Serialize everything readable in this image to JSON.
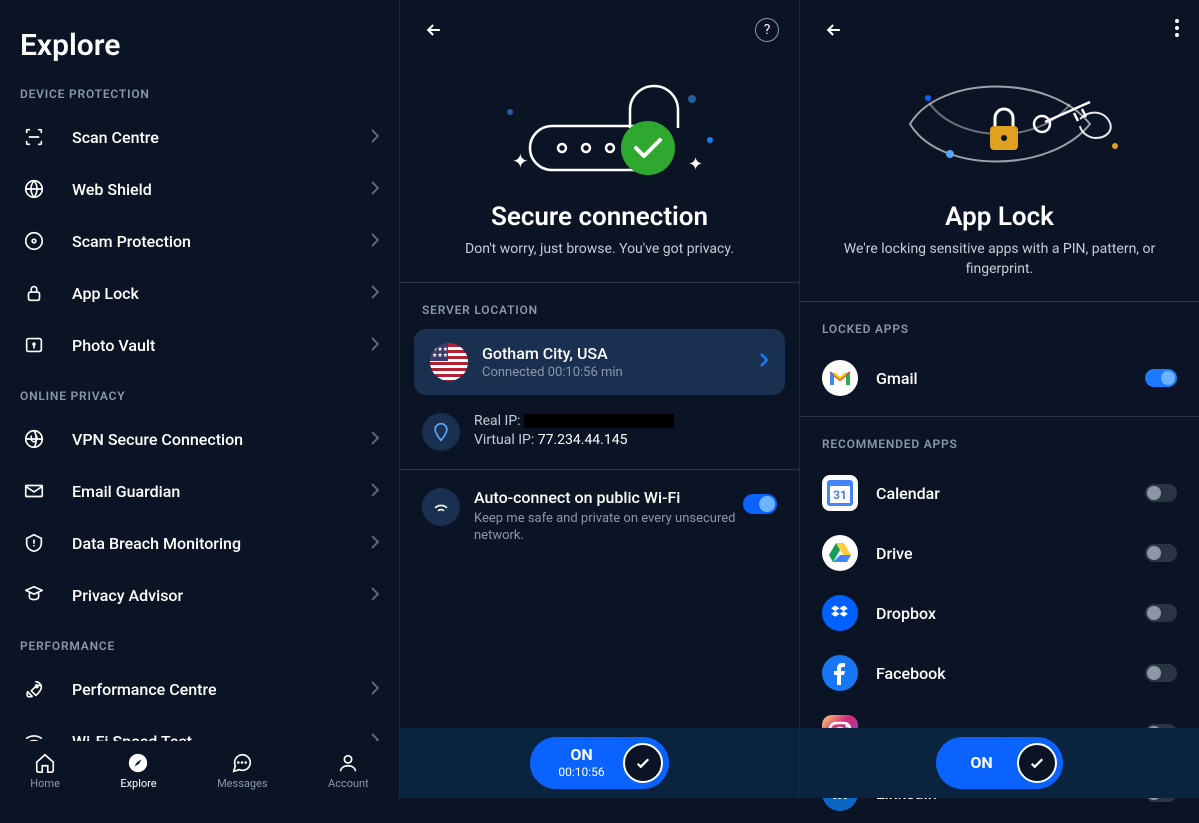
{
  "panel1": {
    "title": "Explore",
    "sections": [
      {
        "header": "DEVICE PROTECTION",
        "items": [
          {
            "label": "Scan Centre",
            "icon": "scan-icon"
          },
          {
            "label": "Web Shield",
            "icon": "globe-icon"
          },
          {
            "label": "Scam Protection",
            "icon": "scam-icon"
          },
          {
            "label": "App Lock",
            "icon": "lock-icon"
          },
          {
            "label": "Photo Vault",
            "icon": "vault-icon"
          }
        ]
      },
      {
        "header": "ONLINE PRIVACY",
        "items": [
          {
            "label": "VPN Secure Connection",
            "icon": "vpn-icon"
          },
          {
            "label": "Email Guardian",
            "icon": "email-icon"
          },
          {
            "label": "Data Breach Monitoring",
            "icon": "breach-icon"
          },
          {
            "label": "Privacy Advisor",
            "icon": "advisor-icon"
          }
        ]
      },
      {
        "header": "PERFORMANCE",
        "items": [
          {
            "label": "Performance Centre",
            "icon": "rocket-icon"
          },
          {
            "label": "Wi-Fi Speed Test",
            "icon": "wifi-icon"
          }
        ]
      }
    ],
    "nav": [
      {
        "label": "Home",
        "active": false
      },
      {
        "label": "Explore",
        "active": true
      },
      {
        "label": "Messages",
        "active": false
      },
      {
        "label": "Account",
        "active": false
      }
    ]
  },
  "panel2": {
    "title": "Secure connection",
    "subtitle": "Don't worry, just browse. You've got privacy.",
    "server_header": "SERVER LOCATION",
    "server": {
      "name": "Gotham City, USA",
      "status": "Connected 00:10:56 min"
    },
    "ip": {
      "real_label": "Real IP:",
      "virtual_label": "Virtual IP:",
      "virtual_value": "77.234.44.145"
    },
    "auto": {
      "title": "Auto-connect on public Wi-Fi",
      "desc": "Keep me safe and private on every unsecured network.",
      "on": true
    },
    "big_toggle": {
      "label": "ON",
      "time": "00:10:56"
    }
  },
  "panel3": {
    "title": "App Lock",
    "subtitle": "We're locking sensitive apps with a PIN, pattern, or fingerprint.",
    "locked_header": "LOCKED APPS",
    "recommended_header": "RECOMMENDED APPS",
    "locked": [
      {
        "name": "Gmail",
        "on": true,
        "color": "#fff"
      }
    ],
    "recommended": [
      {
        "name": "Calendar",
        "on": false,
        "color": "#4285f4"
      },
      {
        "name": "Drive",
        "on": false,
        "color": "#4caf50"
      },
      {
        "name": "Dropbox",
        "on": false,
        "color": "#0061ff"
      },
      {
        "name": "Facebook",
        "on": false,
        "color": "#1877f2"
      },
      {
        "name": "Instagram",
        "on": false,
        "color": "#e4405f"
      },
      {
        "name": "LinkedIn",
        "on": false,
        "color": "#0a66c2"
      }
    ],
    "big_toggle": {
      "label": "ON"
    }
  }
}
